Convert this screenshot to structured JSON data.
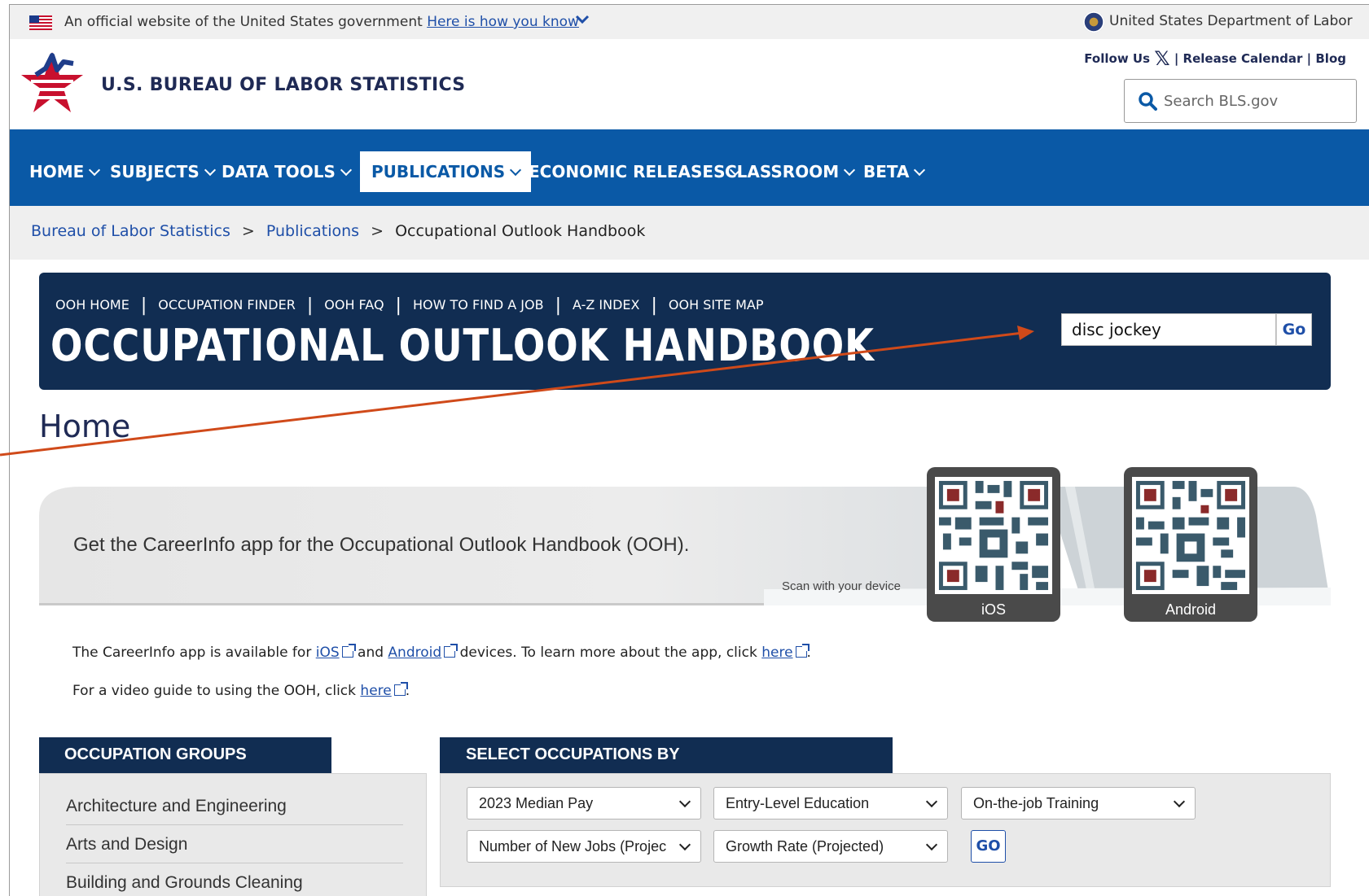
{
  "gov_banner": {
    "official_text": "An official website of the United States government",
    "how_you_know": "Here is how you know",
    "department": "United States Department of Labor"
  },
  "header": {
    "site_title": "U.S. BUREAU OF LABOR STATISTICS",
    "follow_us": "Follow Us",
    "release_calendar": "Release Calendar",
    "blog": "Blog",
    "search_placeholder": "Search BLS.gov"
  },
  "nav": {
    "items": [
      {
        "label": "HOME"
      },
      {
        "label": "SUBJECTS"
      },
      {
        "label": "DATA TOOLS"
      },
      {
        "label": "PUBLICATIONS"
      },
      {
        "label": "ECONOMIC RELEASES"
      },
      {
        "label": "CLASSROOM"
      },
      {
        "label": "BETA"
      }
    ],
    "active": "PUBLICATIONS"
  },
  "breadcrumb": {
    "items": [
      "Bureau of Labor Statistics",
      "Publications",
      "Occupational Outlook Handbook"
    ],
    "separator": ">"
  },
  "ooh": {
    "links": [
      "OOH HOME",
      "OCCUPATION FINDER",
      "OOH FAQ",
      "HOW TO FIND A JOB",
      "A-Z INDEX",
      "OOH SITE MAP"
    ],
    "title": "OCCUPATIONAL OUTLOOK HANDBOOK",
    "search_value": "disc jockey",
    "go_label": "Go"
  },
  "page": {
    "heading": "Home"
  },
  "promo": {
    "text": "Get the CareerInfo app for the Occupational Outlook Handbook (OOH).",
    "scan_text": "Scan with your device",
    "ios_label": "iOS",
    "android_label": "Android"
  },
  "info": {
    "line1_a": "The CareerInfo app is available for",
    "ios_link": "iOS",
    "line1_and": "and",
    "android_link": "Android",
    "line1_b": "devices. To learn more about the app, click",
    "here_link": "here",
    "period": ".",
    "line2_a": "For a video guide to using the OOH, click",
    "here_link2": "here"
  },
  "occupation_groups": {
    "header": "OCCUPATION GROUPS",
    "items": [
      "Architecture and Engineering",
      "Arts and Design",
      "Building and Grounds Cleaning"
    ]
  },
  "select_occupations": {
    "header": "SELECT OCCUPATIONS BY",
    "selects": [
      "2023 Median Pay",
      "Entry-Level Education",
      "On-the-job Training",
      "Number of New Jobs (Projected)",
      "Growth Rate (Projected)"
    ],
    "go_label": "GO"
  },
  "colors": {
    "nav_blue": "#0a59a6",
    "navy": "#112d52",
    "annotation_arrow": "#d04a1a",
    "star_red": "#c8102e"
  }
}
